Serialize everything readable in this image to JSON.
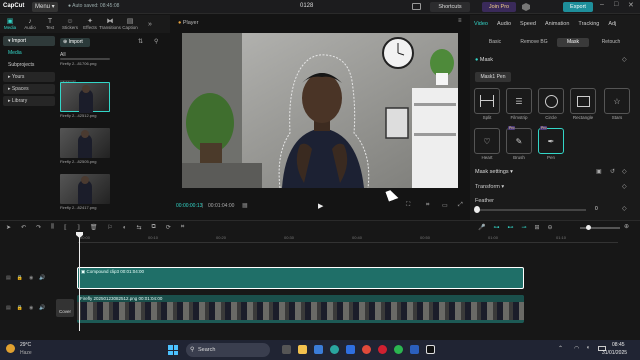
{
  "app": {
    "logo": "CapCut",
    "menu": "Menu",
    "autosave": "Auto saved: 08:45:08",
    "title": "0128"
  },
  "titlebar": {
    "shortcuts": "Shortcuts",
    "join_pro": "Join Pro",
    "export": "Export"
  },
  "tools": [
    {
      "icon": "media-icon",
      "label": "Media"
    },
    {
      "icon": "audio-icon",
      "label": "Audio"
    },
    {
      "icon": "text-icon",
      "label": "Text"
    },
    {
      "icon": "stickers-icon",
      "label": "Stickers"
    },
    {
      "icon": "effects-icon",
      "label": "Effects"
    },
    {
      "icon": "transitions-icon",
      "label": "Transitions"
    },
    {
      "icon": "captions-icon",
      "label": "Caption"
    },
    {
      "icon": "more-icon",
      "label": ""
    }
  ],
  "leftnav": {
    "import": "Import",
    "media": "Media",
    "subprojects": "Subprojects",
    "yours": "Yours",
    "spaces": "Spaces",
    "library": "Library"
  },
  "media_panel": {
    "import_btn": "Import",
    "all": "All",
    "added": "Added",
    "files": [
      "Firefly 2...81706.png",
      "Firefly 2...42512.png",
      "Firefly 2...82505.png",
      "Firefly 2...82417.png"
    ]
  },
  "player": {
    "label": "Player",
    "time_current": "00:00:00:13",
    "time_total": "00:01:04:00"
  },
  "right_panel": {
    "tabs": [
      "Video",
      "Audio",
      "Speed",
      "Animation",
      "Tracking",
      "Adj"
    ],
    "subtabs": [
      "Basic",
      "Remove BG",
      "Mask",
      "Retouch"
    ],
    "mask_header": "Mask",
    "mask_pen_chip": "Mask1 Pen",
    "shapes": [
      "Split",
      "Filmstrip",
      "Circle",
      "Rectangle",
      "Stars",
      "Heart",
      "Brush",
      "Pen"
    ],
    "mask_settings": "Mask settings",
    "transform": "Transform",
    "feather": "Feather",
    "feather_value": "0",
    "pro_badge": "Pro"
  },
  "timeline": {
    "ruler": [
      "00:00",
      "00:10",
      "00:20",
      "00:30",
      "00:40",
      "00:50",
      "01:00",
      "01:10"
    ],
    "compound_clip": "Compound clip3  00:01:04:00",
    "main_clip": "Firefly 20250123082512.png  00:01:04:00",
    "cover": "Cover"
  },
  "taskbar": {
    "temp": "29°C",
    "weather": "Haze",
    "search": "Search",
    "time": "08:45",
    "date": "31/01/2025"
  }
}
